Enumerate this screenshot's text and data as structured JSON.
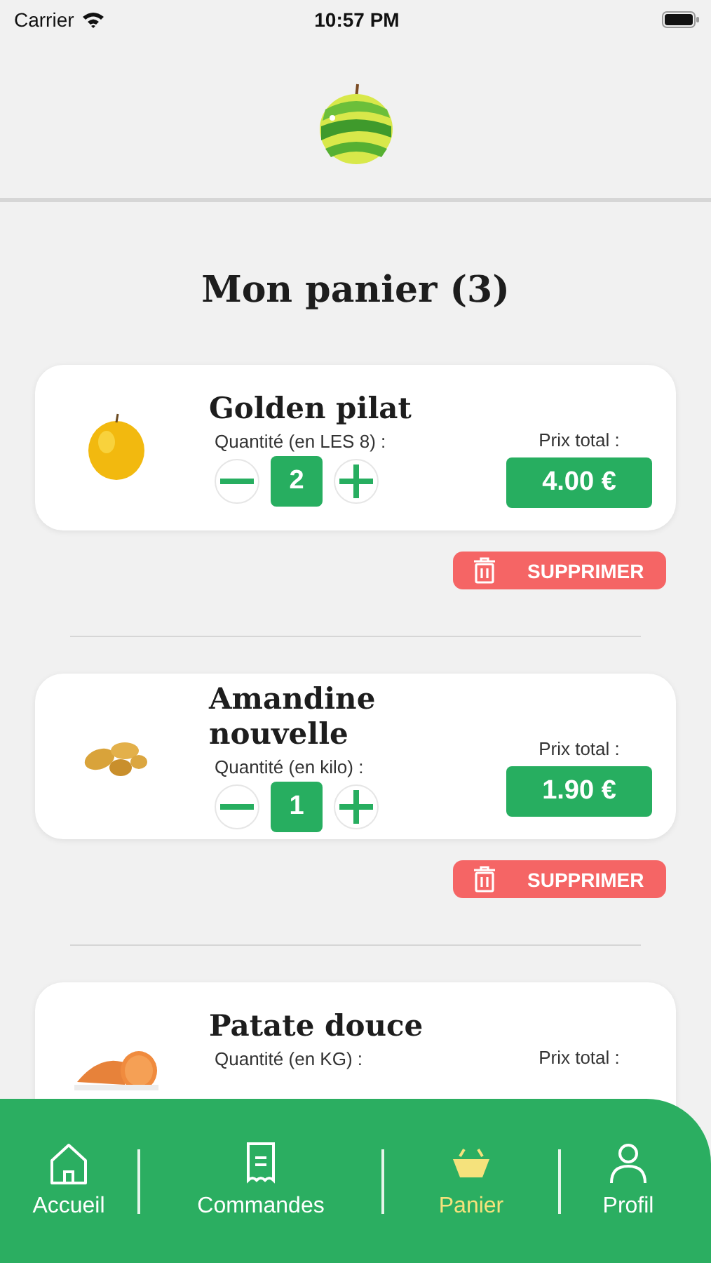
{
  "status_bar": {
    "carrier": "Carrier",
    "time": "10:57 PM"
  },
  "title": "Mon panier (3)",
  "items": [
    {
      "name": "Golden pilat",
      "quantity_label": "Quantité (en LES 8) :",
      "quantity": "2",
      "price_label": "Prix total :",
      "price": "4.00 €",
      "delete": "SUPPRIMER"
    },
    {
      "name": "Amandine nouvelle",
      "quantity_label": "Quantité (en kilo) :",
      "quantity": "1",
      "price_label": "Prix total :",
      "price": "1.90 €",
      "delete": "SUPPRIMER"
    },
    {
      "name": "Patate douce",
      "quantity_label": "Quantité (en KG) :",
      "price_label": "Prix total :"
    }
  ],
  "tabs": [
    {
      "label": "Accueil",
      "selected": false
    },
    {
      "label": "Commandes",
      "selected": false
    },
    {
      "label": "Panier",
      "selected": true
    },
    {
      "label": "Profil",
      "selected": false
    }
  ]
}
